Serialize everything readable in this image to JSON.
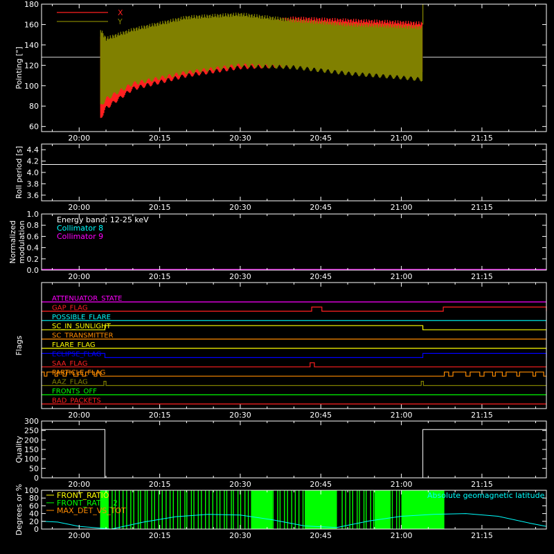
{
  "time_ticks": [
    "20:00",
    "20:15",
    "20:30",
    "20:45",
    "21:00",
    "21:15"
  ],
  "chart_data": [
    {
      "type": "line",
      "ylabel": "Pointing [\"]",
      "ylim": [
        55,
        180
      ],
      "yticks": [
        60,
        80,
        100,
        120,
        140,
        160,
        180
      ],
      "reference_line": 128,
      "data_window": [
        "20:04",
        "21:04"
      ],
      "series": [
        {
          "name": "X",
          "color": "#ff2020",
          "band_x": [
            "20:04",
            "20:05",
            "20:10",
            "20:20",
            "20:30",
            "20:40",
            "20:50",
            "21:00",
            "21:04"
          ],
          "band_low": [
            68,
            78,
            97,
            110,
            118,
            120,
            118,
            114,
            113
          ],
          "band_high": [
            150,
            142,
            150,
            157,
            160,
            166,
            164,
            162,
            161
          ]
        },
        {
          "name": "Y",
          "color": "#808000",
          "band_x": [
            "20:04",
            "20:05",
            "20:10",
            "20:20",
            "20:30",
            "20:40",
            "20:50",
            "21:00",
            "21:04"
          ],
          "band_low": [
            80,
            87,
            102,
            113,
            120,
            118,
            112,
            108,
            106
          ],
          "band_high": [
            155,
            146,
            155,
            167,
            170,
            164,
            160,
            158,
            157
          ]
        }
      ]
    },
    {
      "type": "line",
      "ylabel": "Roll period [s]",
      "ylim": [
        3.5,
        4.5
      ],
      "yticks": [
        3.6,
        3.8,
        4.0,
        4.2,
        4.4
      ],
      "series": [
        {
          "x": [
            "19:53",
            "21:27"
          ],
          "values": [
            4.14,
            4.14
          ],
          "color": "#ffffff"
        }
      ]
    },
    {
      "type": "line",
      "ylabel": [
        "Normalized",
        "modulation"
      ],
      "ylim": [
        0.0,
        1.0
      ],
      "yticks": [
        0.0,
        0.2,
        0.4,
        0.6,
        0.8,
        1.0
      ],
      "annotations": [
        {
          "text": "Energy band: 12-25 keV",
          "color": "#ffffff"
        },
        {
          "text": "Collimator 8",
          "color": "#00ffff"
        },
        {
          "text": "Collimator 9",
          "color": "#ff00ff"
        }
      ],
      "series": [
        {
          "x": [
            "19:53",
            "21:27"
          ],
          "values": [
            0.0,
            0.0
          ],
          "color": "#ff00ff"
        }
      ]
    },
    {
      "type": "line",
      "ylabel": "Flags",
      "series": [
        {
          "name": "ATTENUATOR_STATE",
          "color": "#ff00ff",
          "segments": []
        },
        {
          "name": "GAP_FLAG",
          "color": "#ff2020",
          "segments": [
            [
              "20:43.3",
              "20:45.2"
            ],
            [
              "21:07.8",
              "21:27"
            ]
          ]
        },
        {
          "name": "POSSIBLE_FLARE",
          "color": "#00ffff",
          "segments": []
        },
        {
          "name": "SC_IN_SUNLIGHT",
          "color": "#ffff00",
          "segments": [
            [
              "20:04.8",
              "21:04"
            ]
          ]
        },
        {
          "name": "SC_TRANSMITTER",
          "color": "#ff8c00",
          "segments": []
        },
        {
          "name": "FLARE_FLAG",
          "color": "#ffff00",
          "segments": []
        },
        {
          "name": "ECLIPSE_FLAG",
          "color": "#0000ff",
          "segments": [
            [
              "19:53",
              "20:04.8"
            ],
            [
              "21:04",
              "21:27"
            ]
          ]
        },
        {
          "name": "SAA_FLAG",
          "color": "#ff2020",
          "segments": [
            [
              "20:43",
              "20:43.8"
            ]
          ]
        },
        {
          "name": "PARTICLE_FLAG",
          "color": "#ff8c00",
          "segments": [
            [
              "19:53",
              "19:53.5"
            ],
            [
              "19:54",
              "19:55.5"
            ],
            [
              "19:56",
              "19:57"
            ],
            [
              "19:57.6",
              "19:59"
            ],
            [
              "19:59.8",
              "20:00.6"
            ],
            [
              "20:01.2",
              "20:02.8"
            ],
            [
              "20:03.3",
              "20:04"
            ],
            [
              "21:08",
              "21:08.8"
            ],
            [
              "21:09.6",
              "21:12"
            ],
            [
              "21:12.8",
              "21:14.6"
            ],
            [
              "21:15.4",
              "21:17"
            ],
            [
              "21:17.5",
              "21:18.8"
            ],
            [
              "21:19.5",
              "21:21.5"
            ],
            [
              "21:22",
              "21:24.5"
            ],
            [
              "21:25",
              "21:26.5"
            ]
          ]
        },
        {
          "name": "AAZ_FLAG",
          "color": "#808000",
          "segments": [
            [
              "20:04.6",
              "20:05.0"
            ],
            [
              "21:03.7",
              "21:04.1"
            ]
          ]
        },
        {
          "name": "FRONTS_OFF",
          "color": "#00ff00",
          "segments": []
        },
        {
          "name": "BAD_PACKETS",
          "color": "#ff2020",
          "segments": []
        }
      ]
    },
    {
      "type": "line",
      "ylabel": "Quality",
      "ylim": [
        0,
        300
      ],
      "yticks": [
        0,
        50,
        100,
        150,
        200,
        250,
        300
      ],
      "series": [
        {
          "x": [
            "19:53",
            "20:04.8",
            "20:04.8",
            "21:04",
            "21:04",
            "21:27"
          ],
          "values": [
            255,
            255,
            0,
            0,
            255,
            255
          ],
          "color": "#ffffff"
        }
      ]
    },
    {
      "type": "line",
      "ylabel": "Degrees or %",
      "ylim": [
        0,
        100
      ],
      "yticks": [
        0,
        20,
        40,
        60,
        80,
        100
      ],
      "legend": [
        {
          "text": "FRONT_RATIO",
          "color": "#ffff00"
        },
        {
          "text": "FRONT_RATIO_2",
          "color": "#00ff00"
        },
        {
          "text": "MAX_DET_VS_TOT",
          "color": "#ff8c00"
        }
      ],
      "right_label": {
        "text": "Absolute geomagnetic latitude",
        "color": "#00ffff"
      },
      "series": [
        {
          "name": "FRONT_RATIO_2",
          "color": "#00ff00",
          "solid_blocks": [
            [
              "20:04",
              "20:05.5"
            ],
            [
              "20:32",
              "20:36"
            ],
            [
              "20:42",
              "20:48"
            ],
            [
              "20:55",
              "20:58"
            ],
            [
              "21:00",
              "21:08"
            ]
          ],
          "spike_window": [
            "20:04",
            "21:08"
          ],
          "gap": [
            "20:45.5",
            "20:48.5"
          ],
          "value": 100
        },
        {
          "name": "Absolute geomagnetic latitude",
          "color": "#00ffff",
          "x": [
            "19:53",
            "19:56",
            "20:00",
            "20:06",
            "20:12",
            "20:18",
            "20:24",
            "20:30",
            "20:36",
            "20:42",
            "20:48",
            "20:54",
            "21:00",
            "21:06",
            "21:12",
            "21:18",
            "21:24",
            "21:27"
          ],
          "values": [
            20,
            18,
            7,
            0,
            18,
            32,
            38,
            36,
            24,
            8,
            4,
            21,
            33,
            38,
            40,
            33,
            15,
            7
          ]
        }
      ]
    }
  ]
}
